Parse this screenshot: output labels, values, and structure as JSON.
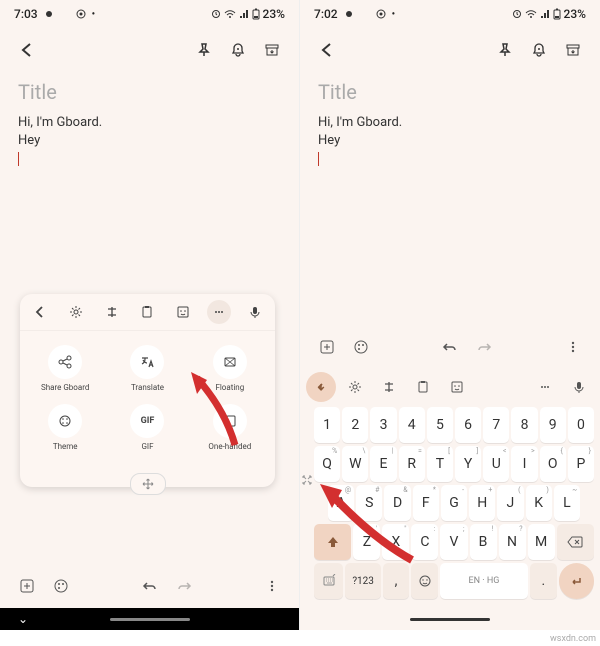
{
  "left": {
    "status": {
      "time": "7:03",
      "battery": "23%"
    },
    "title_placeholder": "Title",
    "note_line1": "Hi, I'm Gboard.",
    "note_line2": "Hey",
    "panel": {
      "items": [
        {
          "label": "Share Gboard"
        },
        {
          "label": "Translate"
        },
        {
          "label": "Floating"
        },
        {
          "label": "Theme"
        },
        {
          "label": "GIF"
        },
        {
          "label": "One-handed"
        }
      ],
      "gif_label": "GIF"
    }
  },
  "right": {
    "status": {
      "time": "7:02",
      "battery": "23%"
    },
    "title_placeholder": "Title",
    "note_line1": "Hi, I'm Gboard.",
    "note_line2": "Hey",
    "keyboard": {
      "row_num": [
        "1",
        "2",
        "3",
        "4",
        "5",
        "6",
        "7",
        "8",
        "9",
        "0"
      ],
      "row1": [
        "Q",
        "W",
        "E",
        "R",
        "T",
        "Y",
        "U",
        "I",
        "O",
        "P"
      ],
      "row1_hints": [
        "%",
        "\\",
        "|",
        "=",
        "[",
        "]",
        "<",
        ">",
        "{",
        "}"
      ],
      "row2": [
        "A",
        "S",
        "D",
        "F",
        "G",
        "H",
        "J",
        "K",
        "L"
      ],
      "row2_hints": [
        "@",
        "#",
        "&",
        "*",
        "-",
        "+",
        "(",
        ")",
        "~"
      ],
      "row3": [
        "Z",
        "X",
        "C",
        "V",
        "B",
        "N",
        "M"
      ],
      "row3_hints": [
        "'",
        "\"",
        ":",
        ";",
        "!",
        "?",
        ""
      ],
      "sym_key": "?123",
      "space_label": "EN · HG"
    }
  },
  "watermark": "wsxdn.com"
}
